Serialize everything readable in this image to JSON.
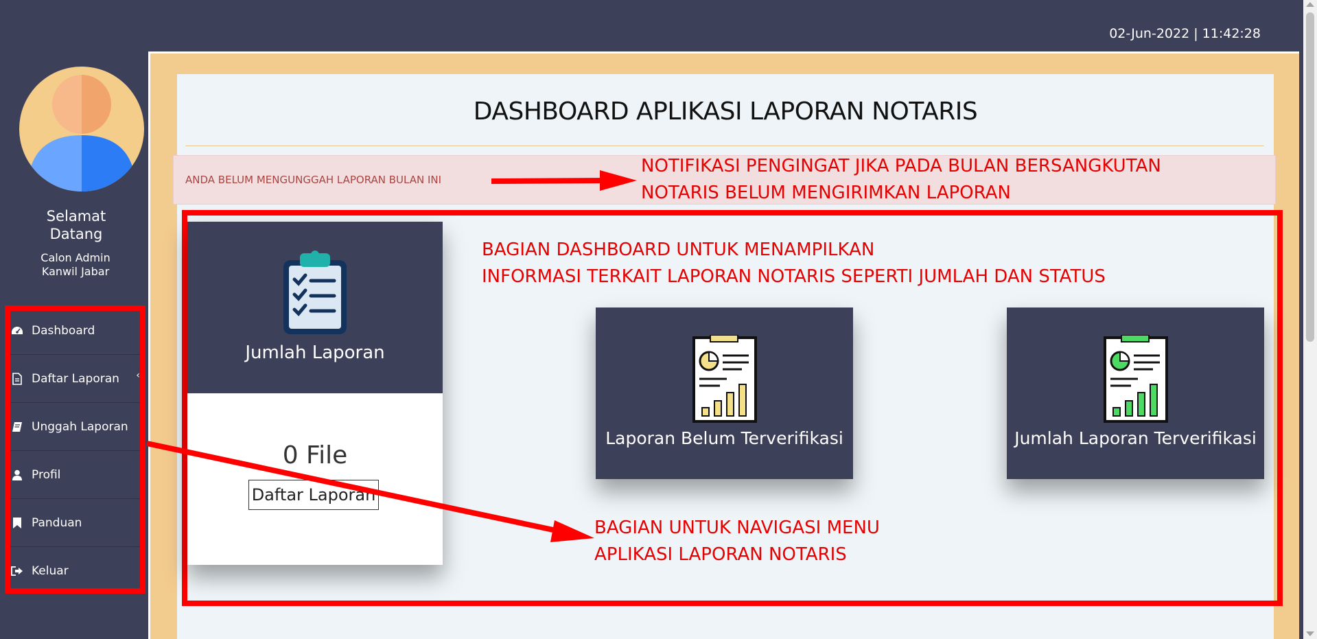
{
  "header": {
    "datetime": "02-Jun-2022 | 11:42:28"
  },
  "sidebar": {
    "welcome": "Selamat Datang",
    "role_line1": "Calon Admin",
    "role_line2": "Kanwil Jabar",
    "items": [
      {
        "label": "Dashboard",
        "icon": "dashboard-icon"
      },
      {
        "label": "Daftar Laporan",
        "icon": "document-icon",
        "expandable": true
      },
      {
        "label": "Unggah Laporan",
        "icon": "book-icon"
      },
      {
        "label": "Profil",
        "icon": "user-icon"
      },
      {
        "label": "Panduan",
        "icon": "bookmark-icon"
      },
      {
        "label": "Keluar",
        "icon": "sign-out-icon"
      }
    ]
  },
  "main": {
    "title": "DASHBOARD APLIKASI LAPORAN NOTARIS",
    "alert": "ANDA BELUM MENGUNGGAH LAPORAN BULAN INI",
    "cards": {
      "jumlah": {
        "label": "Jumlah Laporan",
        "count": "0 File",
        "button": "Daftar Laporan"
      },
      "belum": {
        "label": "Laporan Belum Terverifikasi"
      },
      "terverifikasi": {
        "label": "Jumlah Laporan Terverifikasi"
      }
    }
  },
  "annotations": {
    "notif_line1": "NOTIFIKASI PENGINGAT JIKA PADA BULAN BERSANGKUTAN",
    "notif_line2": "NOTARIS BELUM MENGIRIMKAN LAPORAN",
    "dash_line1": "BAGIAN DASHBOARD UNTUK MENAMPILKAN",
    "dash_line2": "INFORMASI TERKAIT LAPORAN NOTARIS SEPERTI JUMLAH DAN STATUS",
    "nav_line1": "BAGIAN UNTUK NAVIGASI MENU",
    "nav_line2": "APLIKASI LAPORAN NOTARIS"
  },
  "colors": {
    "accent": "#3d4059",
    "annotation": "#ff0000",
    "frame": "#f2cb8f",
    "alert_bg": "#f2dede"
  }
}
